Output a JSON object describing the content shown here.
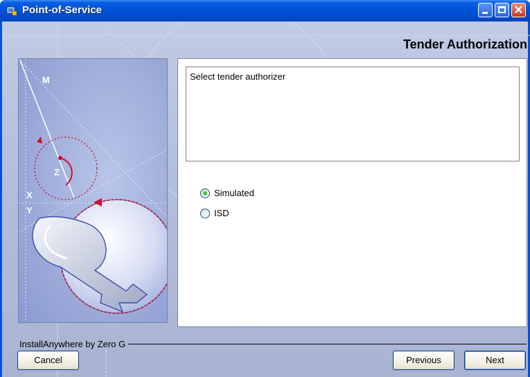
{
  "window": {
    "title": "Point-of-Service",
    "controls": [
      "minimize-icon",
      "maximize-icon",
      "close-icon"
    ],
    "close_glyph": "✕"
  },
  "panel": {
    "title": "Tender Authorization",
    "description": "Select tender authorizer"
  },
  "illustration": {
    "labels": [
      "M",
      "Z",
      "X",
      "Y"
    ]
  },
  "options": {
    "items": [
      {
        "label": "Simulated",
        "selected": true
      },
      {
        "label": "ISD",
        "selected": false
      }
    ]
  },
  "footer": {
    "brand": "InstallAnywhere by Zero G",
    "cancel_label": "Cancel",
    "previous_label": "Previous",
    "next_label": "Next"
  },
  "colors": {
    "titlebar": "#0052d6",
    "body": "#b4bfdc",
    "accent_red": "#d0102a"
  }
}
